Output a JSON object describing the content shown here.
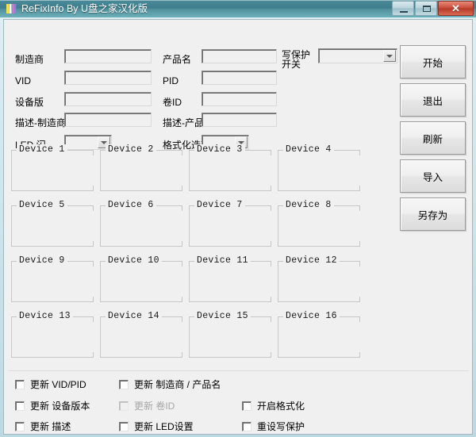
{
  "window": {
    "title": "ReFixInfo By U盘之家汉化版",
    "icon": "app-colorbars-icon",
    "controls": {
      "minimize": "minimize-icon",
      "maximize": "maximize-icon",
      "close": "✕"
    },
    "accent_color": "#3f7f8d",
    "client_bg": "#f0f0f0"
  },
  "form": {
    "fields": [
      {
        "label": "制造商",
        "value": "",
        "type": "text"
      },
      {
        "label": "产品名",
        "value": "",
        "type": "text"
      },
      {
        "label": "VID",
        "value": "",
        "type": "text"
      },
      {
        "label": "PID",
        "value": "",
        "type": "text"
      },
      {
        "label": "设备版",
        "value": "",
        "type": "text"
      },
      {
        "label": "卷ID",
        "value": "",
        "type": "text"
      },
      {
        "label": "描述-制造商",
        "value": "",
        "type": "text"
      },
      {
        "label": "描述-产品",
        "value": "",
        "type": "text"
      }
    ],
    "write_protect": {
      "label_line1": "写保护",
      "label_line2": "开关",
      "value": "",
      "type": "combo"
    },
    "led_flash": {
      "label": "LED 闪",
      "value": "",
      "type": "combo"
    },
    "format_option": {
      "label": "格式化选项",
      "value": "",
      "type": "combo"
    }
  },
  "buttons": [
    {
      "label": "开始",
      "name": "start-button"
    },
    {
      "label": "退出",
      "name": "exit-button"
    },
    {
      "label": "刷新",
      "name": "refresh-button"
    },
    {
      "label": "导入",
      "name": "import-button"
    },
    {
      "label": "另存为",
      "name": "save-as-button"
    }
  ],
  "devices": [
    "Device 1",
    "Device 2",
    "Device 3",
    "Device 4",
    "Device 5",
    "Device 6",
    "Device 7",
    "Device 8",
    "Device 9",
    "Device 10",
    "Device 11",
    "Device 12",
    "Device 13",
    "Device 14",
    "Device 15",
    "Device 16"
  ],
  "checkboxes": [
    {
      "label": "更新 VID/PID",
      "checked": false,
      "enabled": true,
      "name": "update-vid-pid-checkbox"
    },
    {
      "label": "更新 制造商 / 产品名",
      "checked": false,
      "enabled": true,
      "name": "update-manufacturer-product-checkbox"
    },
    {
      "label": "更新 设备版本",
      "checked": false,
      "enabled": true,
      "name": "update-device-version-checkbox"
    },
    {
      "label": "更新 卷ID",
      "checked": false,
      "enabled": false,
      "name": "update-volume-id-checkbox"
    },
    {
      "label": "开启格式化",
      "checked": false,
      "enabled": true,
      "name": "enable-format-checkbox"
    },
    {
      "label": "更新 描述",
      "checked": false,
      "enabled": true,
      "name": "update-description-checkbox"
    },
    {
      "label": "更新 LED设置",
      "checked": false,
      "enabled": true,
      "name": "update-led-settings-checkbox"
    },
    {
      "label": "重设写保护",
      "checked": false,
      "enabled": true,
      "name": "reset-write-protect-checkbox"
    }
  ]
}
